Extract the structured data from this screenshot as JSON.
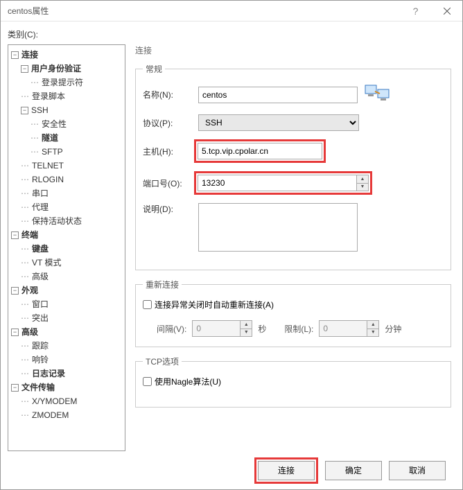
{
  "title": "centos属性",
  "category_label": "类别(C):",
  "tree": {
    "connection": "连接",
    "auth": "用户身份验证",
    "loginprompt": "登录提示符",
    "loginscript": "登录脚本",
    "ssh": "SSH",
    "security": "安全性",
    "tunnel": "隧道",
    "sftp": "SFTP",
    "telnet": "TELNET",
    "rlogin": "RLOGIN",
    "serial": "串口",
    "proxy": "代理",
    "keepalive": "保持活动状态",
    "terminal": "终端",
    "keyboard": "键盘",
    "vtmode": "VT 模式",
    "advanced1": "高级",
    "appearance": "外观",
    "window": "窗口",
    "highlight": "突出",
    "advanced2": "高级",
    "trace": "跟踪",
    "bell": "响铃",
    "logging": "日志记录",
    "filetransfer": "文件传输",
    "xymodem": "X/YMODEM",
    "zmodem": "ZMODEM"
  },
  "right": {
    "heading": "连接",
    "general": {
      "legend": "常规",
      "name_label": "名称(N):",
      "name_value": "centos",
      "proto_label": "协议(P):",
      "proto_value": "SSH",
      "host_label": "主机(H):",
      "host_value": "5.tcp.vip.cpolar.cn",
      "port_label": "端口号(O):",
      "port_value": "13230",
      "desc_label": "说明(D):",
      "desc_value": ""
    },
    "reconnect": {
      "legend": "重新连接",
      "auto_label": "连接异常关闭时自动重新连接(A)",
      "interval_label": "间隔(V):",
      "interval_value": "0",
      "interval_unit": "秒",
      "limit_label": "限制(L):",
      "limit_value": "0",
      "limit_unit": "分钟"
    },
    "tcp": {
      "legend": "TCP选项",
      "nagle_label": "使用Nagle算法(U)"
    }
  },
  "buttons": {
    "connect": "连接",
    "ok": "确定",
    "cancel": "取消"
  }
}
